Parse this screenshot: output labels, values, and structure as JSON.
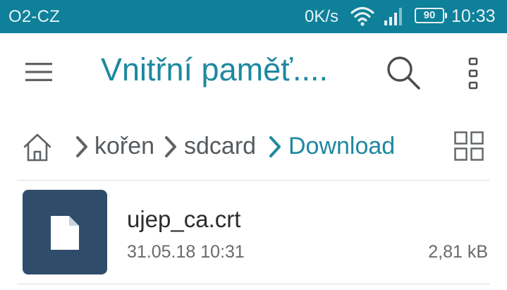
{
  "status_bar": {
    "carrier": "O2-CZ",
    "net_speed": "0K/s",
    "battery": "90",
    "time": "10:33",
    "icons": [
      "wifi-icon",
      "signal-icon",
      "battery-icon"
    ],
    "background": "#0e809a"
  },
  "app_bar": {
    "title": "Vnitřní paměť....",
    "icons": [
      "menu-icon",
      "search-icon",
      "more-vert-icon"
    ],
    "accent": "#1e88a0"
  },
  "breadcrumb": {
    "items": [
      {
        "label": "kořen",
        "active": false
      },
      {
        "label": "sdcard",
        "active": false
      },
      {
        "label": "Download",
        "active": true
      }
    ],
    "icons": [
      "home-icon",
      "chevron-right-icon",
      "grid-view-icon"
    ]
  },
  "files": [
    {
      "name": "ujep_ca.crt",
      "date": "31.05.18 10:31",
      "size": "2,81 kB",
      "icon": "document-icon",
      "thumb_color": "#2f4c6a"
    }
  ]
}
